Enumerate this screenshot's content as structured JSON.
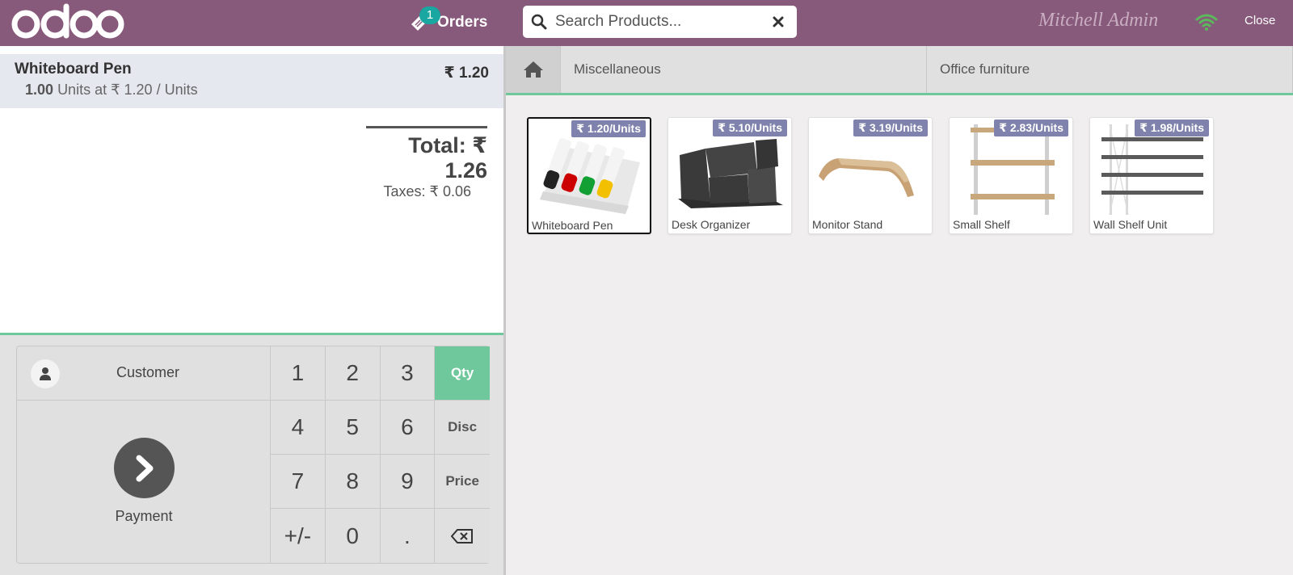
{
  "header": {
    "logo_text": "odoo",
    "orders_label": "Orders",
    "orders_count": "1",
    "search_placeholder": "Search Products...",
    "user_name": "Mitchell Admin",
    "close_label": "Close",
    "colors": {
      "bar": "#875a7b",
      "badge": "#1aa7a1",
      "wifi": "#5cb85c"
    }
  },
  "order": {
    "line": {
      "product": "Whiteboard Pen",
      "price": "₹ 1.20",
      "qty": "1.00",
      "unit_info": "Units at ₹ 1.20 / Units"
    },
    "total": "Total: ₹ 1.26",
    "taxes": "Taxes: ₹ 0.06"
  },
  "controls": {
    "customer_label": "Customer",
    "payment_label": "Payment",
    "keys": [
      "1",
      "2",
      "3",
      "Qty",
      "4",
      "5",
      "6",
      "Disc",
      "7",
      "8",
      "9",
      "Price",
      "+/-",
      "0",
      "."
    ],
    "active_mode": "Qty",
    "accent": "#6ec89b"
  },
  "categories": [
    "Miscellaneous",
    "Office furniture"
  ],
  "products": [
    {
      "name": "Whiteboard Pen",
      "price": "₹ 1.20/Units",
      "icon": "whiteboard-pen-image"
    },
    {
      "name": "Desk Organizer",
      "price": "₹ 5.10/Units",
      "icon": "desk-organizer-image"
    },
    {
      "name": "Monitor Stand",
      "price": "₹ 3.19/Units",
      "icon": "monitor-stand-image"
    },
    {
      "name": "Small Shelf",
      "price": "₹ 2.83/Units",
      "icon": "small-shelf-image"
    },
    {
      "name": "Wall Shelf Unit",
      "price": "₹ 1.98/Units",
      "icon": "wall-shelf-image"
    }
  ]
}
